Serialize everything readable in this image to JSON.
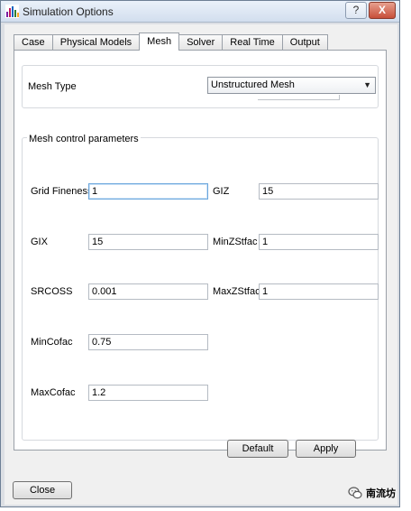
{
  "window": {
    "title": "Simulation Options",
    "help_label": "?",
    "close_label": "X"
  },
  "tabs": [
    {
      "label": "Case"
    },
    {
      "label": "Physical Models"
    },
    {
      "label": "Mesh"
    },
    {
      "label": "Solver"
    },
    {
      "label": "Real Time"
    },
    {
      "label": "Output"
    }
  ],
  "active_tab": "Mesh",
  "mesh_type": {
    "label": "Mesh Type",
    "value": "Unstructured Mesh"
  },
  "mesh_control": {
    "title": "Mesh control parameters",
    "grid_fineness": {
      "label": "Grid Fineness",
      "value": "1"
    },
    "giz": {
      "label": "GIZ",
      "value": "15"
    },
    "gix": {
      "label": "GIX",
      "value": "15"
    },
    "minzstfac": {
      "label": "MinZStfac",
      "value": "1"
    },
    "srcoss": {
      "label": "SRCOSS",
      "value": "0.001"
    },
    "maxzstfac": {
      "label": "MaxZStfac",
      "value": "1"
    },
    "mincofac": {
      "label": "MinCofac",
      "value": "0.75"
    },
    "maxcofac": {
      "label": "MaxCofac",
      "value": "1.2"
    }
  },
  "buttons": {
    "default": "Default",
    "apply": "Apply",
    "close": "Close"
  },
  "watermark": {
    "text": "南流坊"
  }
}
